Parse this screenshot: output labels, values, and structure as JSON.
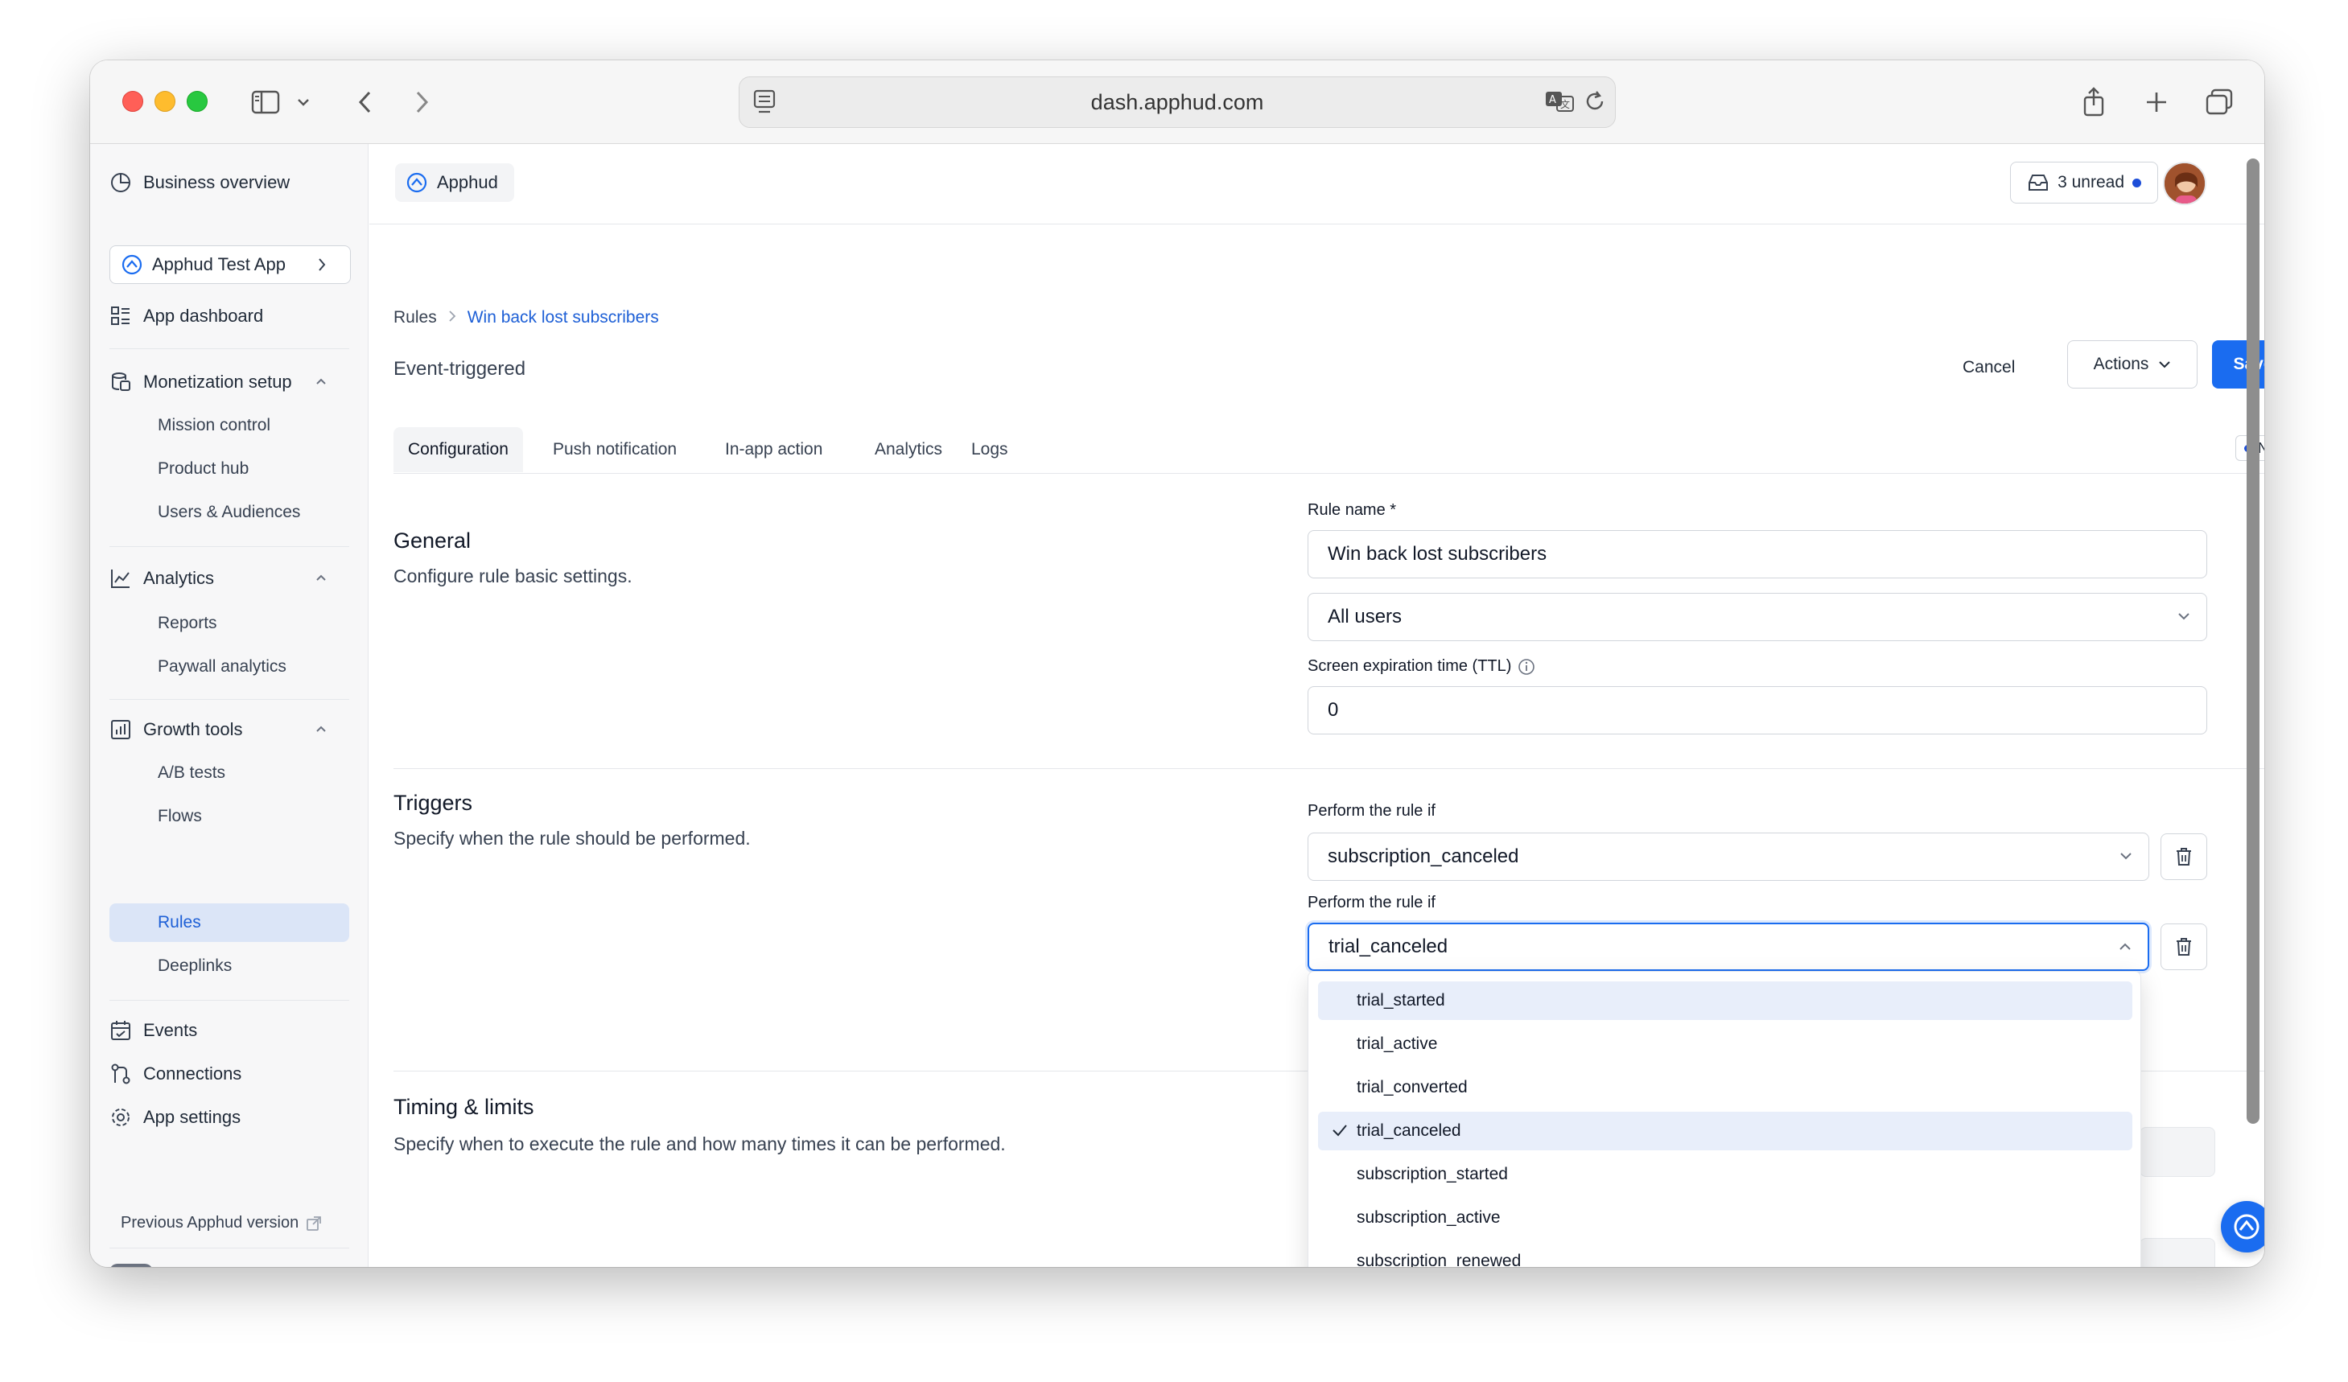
{
  "browser": {
    "url": "dash.apphud.com"
  },
  "sidebar": {
    "business_overview": "Business overview",
    "app_selector": "Apphud Test App",
    "app_dashboard": "App dashboard",
    "monetization": {
      "label": "Monetization setup",
      "items": [
        "Mission control",
        "Product hub",
        "Users & Audiences"
      ]
    },
    "analytics": {
      "label": "Analytics",
      "items": [
        "Reports",
        "Paywall analytics"
      ]
    },
    "growth": {
      "label": "Growth tools",
      "items": [
        "A/B tests",
        "Flows",
        "Rules",
        "Deeplinks"
      ],
      "active": "Rules"
    },
    "events": "Events",
    "connections": "Connections",
    "app_settings": "App settings",
    "previous_version": "Previous Apphud version"
  },
  "topbar": {
    "org": "Apphud",
    "unread": "3 unread"
  },
  "header": {
    "breadcrumb_root": "Rules",
    "breadcrumb_current": "Win back lost subscribers",
    "subtitle": "Event-triggered",
    "cancel": "Cancel",
    "actions": "Actions",
    "save": "Save"
  },
  "tabs": [
    "Configuration",
    "Push notification",
    "In-app action",
    "Analytics",
    "Logs"
  ],
  "active_tab": "Configuration",
  "badge_new": "New",
  "general": {
    "title": "General",
    "description": "Configure rule basic settings.",
    "rule_name_label": "Rule name *",
    "rule_name_value": "Win back lost subscribers",
    "audience_value": "All users",
    "ttl_label": "Screen expiration time (TTL)",
    "ttl_value": "0"
  },
  "triggers": {
    "title": "Triggers",
    "description": "Specify when the rule should be performed.",
    "condition1_label": "Perform the rule if",
    "condition1_value": "subscription_canceled",
    "condition2_label": "Perform the rule if",
    "condition2_value": "trial_canceled"
  },
  "dropdown": {
    "options": [
      "trial_started",
      "trial_active",
      "trial_converted",
      "trial_canceled",
      "subscription_started",
      "subscription_active",
      "subscription_renewed"
    ],
    "selected": "trial_canceled",
    "hovered": "trial_started"
  },
  "timing": {
    "title": "Timing & limits",
    "description": "Specify when to execute the rule and how many times it can be performed."
  },
  "colors": {
    "accent": "#1a6cf0",
    "link": "#1d5fd6",
    "active_nav": "#dbe5f7"
  }
}
